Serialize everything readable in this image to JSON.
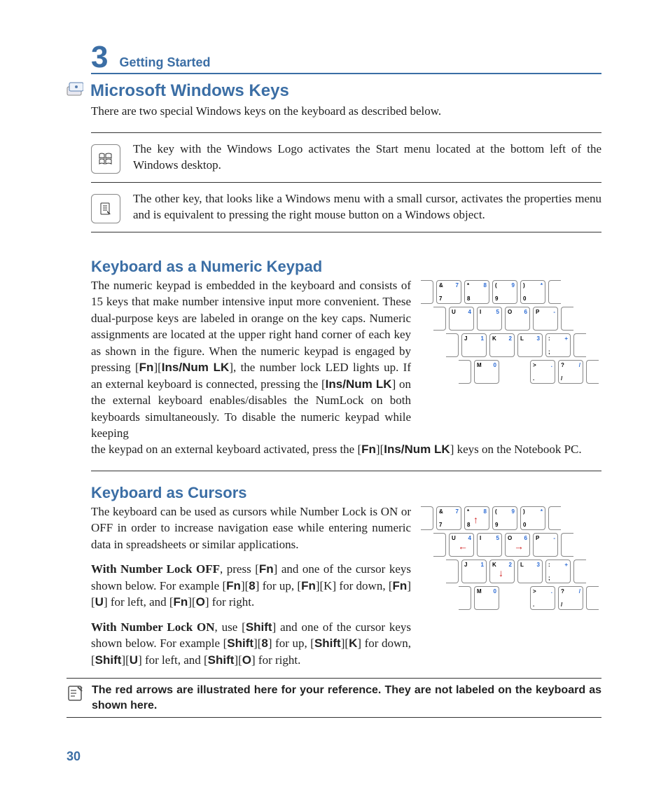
{
  "chapter": {
    "number": "3",
    "title": "Getting Started"
  },
  "section1": {
    "title": "Microsoft Windows Keys",
    "intro": "There are two special Windows keys on the keyboard as described below.",
    "key1": "The key with the Windows Logo activates the Start menu located at the bottom left of the Windows desktop.",
    "key2": "The other key, that looks like a Windows menu with a small cursor, activates the properties menu and is equivalent to pressing the right mouse button on a Windows object."
  },
  "section2": {
    "title": "Keyboard as a Numeric Keypad",
    "text_a": "The numeric keypad is embedded in the keyboard and consists of 15 keys that make number intensive input more convenient. These dual-purpose keys are labeled in orange on the key caps. Numeric assignments are located at the upper right hand corner of each key as shown in the figure. When the numeric keypad is engaged by pressing [",
    "fn1": "Fn",
    "text_b": "][",
    "ins1": "Ins/Num LK",
    "text_c": "], the number lock LED lights up. If an external keyboard is connected, pressing the [",
    "ins2": "Ins/Num LK",
    "text_d": "] on the external keyboard enables/disables the NumLock on both keyboards simultaneously. To disable the numeric keypad while keeping",
    "text_e": "the keypad on an external keyboard activated, press the  [",
    "fn2": "Fn",
    "text_f": "][",
    "ins3": "Ins/Num LK",
    "text_g": "] keys on the Notebook PC."
  },
  "section3": {
    "title": "Keyboard as Cursors",
    "p1": "The keyboard can be used as cursors while Number Lock is ON or OFF in order to increase navigation ease while entering numeric data in spreadsheets or similar applications.",
    "p2_a": "With Number Lock OFF",
    "p2_b": ", press [",
    "p2_c": "Fn",
    "p2_d": "] and one of the cursor keys shown below. For example [",
    "p2_e": "Fn",
    "p2_f": "][",
    "p2_g": "8",
    "p2_h": "] for up, [",
    "p2_i": "Fn",
    "p2_j": "][K] for down, [",
    "p2_k": "Fn",
    "p2_l": "][",
    "p2_m": "U",
    "p2_n": "] for left, and [",
    "p2_o": "Fn",
    "p2_p": "][",
    "p2_q": "O",
    "p2_r": "] for right.",
    "p3_a": "With Number Lock ON",
    "p3_b": ", use [",
    "p3_c": "Shift",
    "p3_d": "] and one of the cursor keys shown below. For example [",
    "p3_e": "Shift",
    "p3_f": "][",
    "p3_g": "8",
    "p3_h": "] for up, [",
    "p3_i": "Shift",
    "p3_j": "][",
    "p3_k": "K",
    "p3_l": "] for down, [",
    "p3_m": "Shift",
    "p3_n": "][",
    "p3_o": "U",
    "p3_p": "] for left, and [",
    "p3_q": "Shift",
    "p3_r": "][",
    "p3_s": "O",
    "p3_t": "] for right."
  },
  "note": "The red arrows are illustrated here for your reference. They are not labeled on the keyboard as shown here.",
  "page_number": "30",
  "keypad": {
    "rows": [
      [
        {
          "tl": "&",
          "tr": "7",
          "bl": "7"
        },
        {
          "tl": "*",
          "tr": "8",
          "bl": "8"
        },
        {
          "tl": "(",
          "tr": "9",
          "bl": "9"
        },
        {
          "tl": ")",
          "tr": "*",
          "bl": "0"
        }
      ],
      [
        {
          "tl": "U",
          "tr": "4"
        },
        {
          "tl": "I",
          "tr": "5"
        },
        {
          "tl": "O",
          "tr": "6"
        },
        {
          "tl": "P",
          "tr": "-"
        }
      ],
      [
        {
          "tl": "J",
          "tr": "1"
        },
        {
          "tl": "K",
          "tr": "2"
        },
        {
          "tl": "L",
          "tr": "3"
        },
        {
          "tl": ":",
          "tr": "+",
          "bl": ";"
        }
      ],
      [
        {
          "tl": "M",
          "tr": "0",
          "bl": ""
        },
        {
          "blank": true
        },
        {
          "tl": ">",
          "tr": ".",
          "bl": "."
        },
        {
          "tl": "?",
          "tr": "/",
          "bl": "/"
        }
      ]
    ]
  }
}
